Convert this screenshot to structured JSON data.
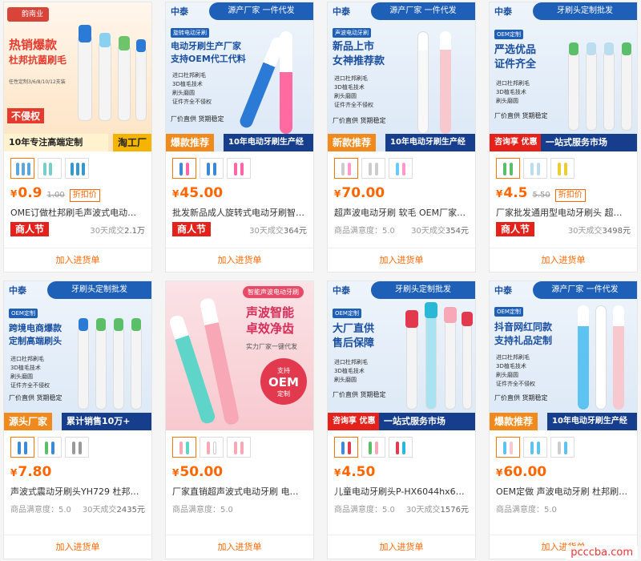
{
  "common": {
    "add_to_cart": "加入进货单",
    "festival": "商人节",
    "sold_label": "30天成交",
    "sat_label": "商品满意度：",
    "yen": "¥"
  },
  "products": [
    {
      "banner": {
        "logo": "韵南业",
        "title1": "热销爆款",
        "title2": "杜邦抗菌刷毛",
        "sub": "任性定制3/6/8/10/12支装",
        "badge": "不侵权",
        "foot_left": "10年专注高端定制",
        "foot_right": "淘工厂"
      },
      "price": "0.9",
      "orig": "1.00",
      "disc": "折扣价",
      "title": "OME订做杜邦刷毛声波式电动牙刷头 ...",
      "sold": "2.1万",
      "festival": true
    },
    {
      "banner": {
        "logo": "中泰",
        "slogan": "源产厂家 一件代发",
        "tag": "旋转电动牙刷",
        "title1": "电动牙刷生产厂家",
        "title2": "支持OEM代工代料",
        "feats": [
          "进口杜邦刷毛",
          "3D植毛技术",
          "刷头磨圆",
          "证件齐全不侵权"
        ],
        "direct": "厂价直供  货期稳定",
        "foot_left": "爆款推荐",
        "foot_right": "10年电动牙刷生产经验"
      },
      "price": "45.00",
      "title": "批发新品成人旋转式电动牙刷智能清...",
      "sold": "364元",
      "festival": true
    },
    {
      "banner": {
        "logo": "中泰",
        "slogan": "源产厂家 一件代发",
        "tag": "声波电动牙刷",
        "title1": "新品上市",
        "title2": "女神推荐款",
        "feats": [
          "进口杜邦刷毛",
          "3D植毛技术",
          "刷头磨圆",
          "证件齐全不侵权"
        ],
        "direct": "厂价直供  货期稳定",
        "foot_left": "新款推荐",
        "foot_right": "10年电动牙刷生产经验"
      },
      "price": "70.00",
      "title": "超声波电动牙刷 软毛 OEM厂家定制 ...",
      "sat": "5.0",
      "sold": "354元",
      "festival": false
    },
    {
      "banner": {
        "logo": "中泰",
        "slogan": "牙刷头定制批发",
        "tag": "OEM定制",
        "title1": "严选优品",
        "title2": "证件齐全",
        "feats": [
          "进口杜邦刷毛",
          "3D植毛技术",
          "刷头磨圆"
        ],
        "direct": "厂价直供  货期稳定",
        "foot_left": "咨询享 优惠",
        "foot_right": "一站式服务市场"
      },
      "price": "4.5",
      "orig": "5.50",
      "disc": "折扣价",
      "title": "厂家批发通用型电动牙刷头 超级清洁...",
      "sold": "3498元",
      "festival": true
    },
    {
      "banner": {
        "logo": "中泰",
        "slogan": "牙刷头定制批发",
        "tag": "OEM定制",
        "title1": "跨境电商爆款",
        "title2": "定制高端刷头",
        "feats": [
          "进口杜邦刷毛",
          "3D植毛技术",
          "刷头磨圆",
          "证件齐全不侵权"
        ],
        "direct": "厂价直供  货期稳定",
        "foot_left": "源头厂家",
        "foot_right": "累计销售10万+"
      },
      "price": "7.80",
      "title": "声波式震动牙刷头YH729 杜邦刷毛 ...",
      "sat": "5.0",
      "sold": "2435元",
      "festival": false
    },
    {
      "banner": {
        "tag": "智能声波电动牙刷",
        "title1": "声波智能",
        "title2": "卓效净齿",
        "sub": "实力厂家一键代发",
        "oem_top": "支持",
        "oem": "OEM",
        "oem_bottom": "定制"
      },
      "price": "50.00",
      "title": "厂家直销超声波式电动牙刷 电子智能...",
      "sat": "5.0",
      "festival": false
    },
    {
      "banner": {
        "logo": "中泰",
        "slogan": "牙刷头定制批发",
        "tag": "OEM定制",
        "title1": "大厂直供",
        "title2": "售后保障",
        "feats": [
          "进口杜邦刷毛",
          "3D植毛技术",
          "刷头磨圆"
        ],
        "direct": "厂价直供  货期稳定",
        "foot_left": "咨询享 优惠",
        "foot_right": "一站式服务市场"
      },
      "price": "4.50",
      "title": "儿童电动牙刷头P-HX6044hx6042升...",
      "sat": "5.0",
      "sold": "1576元",
      "festival": false
    },
    {
      "banner": {
        "logo": "中泰",
        "slogan": "源产厂家 一件代发",
        "tag": "OEM定制",
        "title1": "抖音网红同款",
        "title2": "支持礼品定制",
        "feats": [
          "进口杜邦刷毛",
          "3D植毛技术",
          "刷头磨圆",
          "证件齐全不侵权"
        ],
        "direct": "厂价直供  货期稳定",
        "foot_left": "爆款推荐",
        "foot_right": "10年电动牙刷生产经验"
      },
      "price": "60.00",
      "title": "OEM定做 声波电动牙刷 杜邦刷毛 通...",
      "sat": "5.0",
      "festival": false
    }
  ],
  "watermark": "pcccba.com",
  "colors": {
    "accent": "#ff6600",
    "festival": "#e4211a",
    "brand_blue": "#1e5fb8",
    "footer_blue": "#173e8c"
  }
}
